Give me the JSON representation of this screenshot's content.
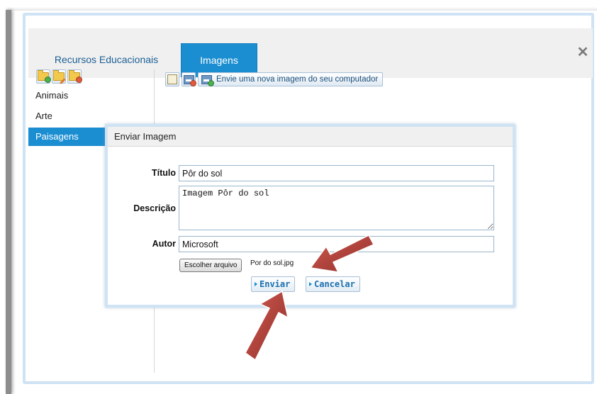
{
  "tabs": [
    {
      "label": "Recursos Educacionais",
      "active": false
    },
    {
      "label": "Imagens",
      "active": true
    }
  ],
  "close_icon": "close-icon",
  "sidebar": {
    "toolbar_icons": [
      "new-folder-icon",
      "edit-folder-icon",
      "delete-folder-icon"
    ],
    "items": [
      {
        "label": "Animais"
      },
      {
        "label": "Arte"
      },
      {
        "label": "Paisagens",
        "selected": true
      }
    ]
  },
  "main_toolbar": {
    "icons": [
      "edit-image-icon",
      "delete-image-icon",
      "upload-image-icon"
    ],
    "upload_label": "Envie uma nova imagem do seu computador"
  },
  "dialog": {
    "title": "Enviar Imagem",
    "titulo_label": "Título",
    "titulo_value": "Pôr do sol",
    "descricao_label": "Descrição",
    "descricao_value": "Imagem Pôr do sol",
    "autor_label": "Autor",
    "autor_value": "Microsoft",
    "file_button_label": "Escolher arquivo",
    "file_name": "Por do sol.jpg",
    "submit_label": "Enviar",
    "cancel_label": "Cancelar"
  },
  "colors": {
    "accent": "#1b8ed2",
    "panel_border": "#cfe3f4",
    "annotation_arrow": "#b5463f"
  }
}
